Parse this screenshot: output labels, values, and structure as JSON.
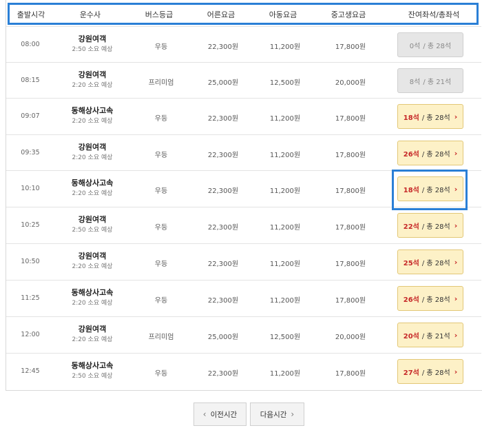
{
  "header": {
    "departure_time": "출발시각",
    "company": "운수사",
    "bus_grade": "버스등급",
    "adult_fare": "어른요금",
    "child_fare": "아동요금",
    "student_fare": "중고생요금",
    "seats": "잔여좌석/총좌석"
  },
  "rows": [
    {
      "time": "08:00",
      "company": "강원여객",
      "duration": "2:50 소요 예상",
      "grade": "우등",
      "adult": "22,300원",
      "child": "11,200원",
      "student": "17,800원",
      "remaining": "0석",
      "total": "/ 총 28석",
      "available": false
    },
    {
      "time": "08:15",
      "company": "강원여객",
      "duration": "2:20 소요 예상",
      "grade": "프리미엄",
      "adult": "25,000원",
      "child": "12,500원",
      "student": "20,000원",
      "remaining": "8석",
      "total": "/ 총 21석",
      "available": false
    },
    {
      "time": "09:07",
      "company": "동해상사고속",
      "duration": "2:20 소요 예상",
      "grade": "우등",
      "adult": "22,300원",
      "child": "11,200원",
      "student": "17,800원",
      "remaining": "18석",
      "total": "/ 총 28석",
      "available": true
    },
    {
      "time": "09:35",
      "company": "강원여객",
      "duration": "2:20 소요 예상",
      "grade": "우등",
      "adult": "22,300원",
      "child": "11,200원",
      "student": "17,800원",
      "remaining": "26석",
      "total": "/ 총 28석",
      "available": true
    },
    {
      "time": "10:10",
      "company": "동해상사고속",
      "duration": "2:20 소요 예상",
      "grade": "우등",
      "adult": "22,300원",
      "child": "11,200원",
      "student": "17,800원",
      "remaining": "18석",
      "total": "/ 총 28석",
      "available": true
    },
    {
      "time": "10:25",
      "company": "강원여객",
      "duration": "2:50 소요 예상",
      "grade": "우등",
      "adult": "22,300원",
      "child": "11,200원",
      "student": "17,800원",
      "remaining": "22석",
      "total": "/ 총 28석",
      "available": true
    },
    {
      "time": "10:50",
      "company": "강원여객",
      "duration": "2:20 소요 예상",
      "grade": "우등",
      "adult": "22,300원",
      "child": "11,200원",
      "student": "17,800원",
      "remaining": "25석",
      "total": "/ 총 28석",
      "available": true
    },
    {
      "time": "11:25",
      "company": "동해상사고속",
      "duration": "2:20 소요 예상",
      "grade": "우등",
      "adult": "22,300원",
      "child": "11,200원",
      "student": "17,800원",
      "remaining": "26석",
      "total": "/ 총 28석",
      "available": true
    },
    {
      "time": "12:00",
      "company": "강원여객",
      "duration": "2:20 소요 예상",
      "grade": "프리미엄",
      "adult": "25,000원",
      "child": "12,500원",
      "student": "20,000원",
      "remaining": "20석",
      "total": "/ 총 21석",
      "available": true
    },
    {
      "time": "12:45",
      "company": "동해상사고속",
      "duration": "2:50 소요 예상",
      "grade": "우등",
      "adult": "22,300원",
      "child": "11,200원",
      "student": "17,800원",
      "remaining": "27석",
      "total": "/ 총 28석",
      "available": true
    }
  ],
  "pagination": {
    "prev_label": "이전시간",
    "next_label": "다음시간",
    "prev_icon": "chevron-left-icon",
    "next_icon": "chevron-right-icon"
  },
  "colors": {
    "highlight": "#2a7fd6",
    "remaining_seats": "#c62828",
    "available_button": "#fdf1c7",
    "unavailable_button": "#e6e6e6"
  }
}
